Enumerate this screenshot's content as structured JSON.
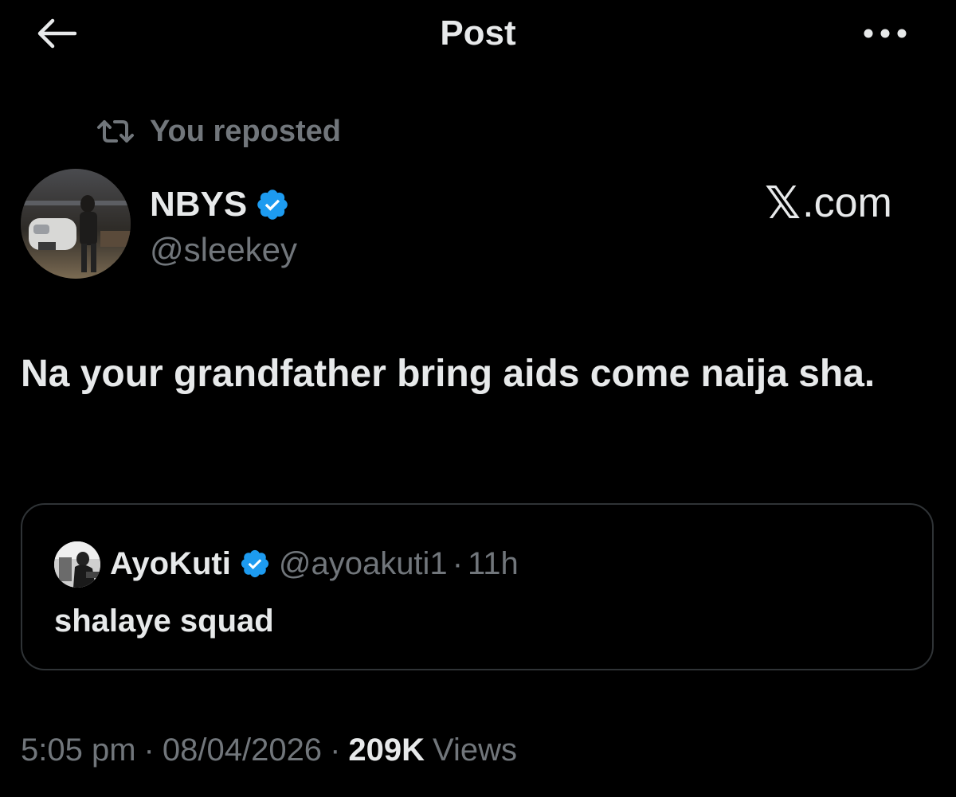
{
  "header": {
    "title": "Post",
    "back_icon": "arrow-left-icon",
    "more_icon": "more-horizontal-icon"
  },
  "repost": {
    "icon": "repost-icon",
    "label": "You reposted"
  },
  "author": {
    "name": "NBYS",
    "handle": "@sleekey",
    "verified_icon": "verified-badge-icon",
    "verified_color": "#1d9bf0"
  },
  "watermark": {
    "x_mark": "𝕏",
    "suffix": ".com"
  },
  "post": {
    "text": "Na your grandfather bring aids come naija sha."
  },
  "quote": {
    "name": "AyoKuti",
    "handle": "@ayoakuti1",
    "separator": "·",
    "time": "11h",
    "text": "shalaye squad"
  },
  "meta": {
    "time": "5:05 pm",
    "separator": "·",
    "date": "08/04/2026",
    "views_count": "209K",
    "views_label": "Views"
  },
  "colors": {
    "background": "#000000",
    "text_primary": "#e7e9ea",
    "text_muted": "#71767b",
    "border": "#2f3336",
    "accent": "#1d9bf0"
  }
}
